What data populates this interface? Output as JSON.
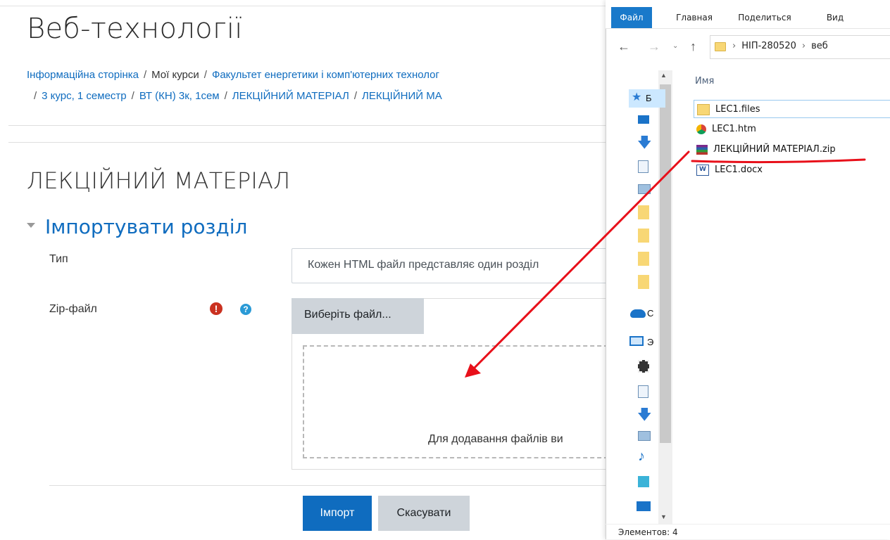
{
  "page": {
    "course_title": "Веб-технології",
    "breadcrumb_line1": [
      "Інформаційна сторінка",
      "Мої курси",
      "Факультет енергетики і комп'ютерних технолог"
    ],
    "breadcrumb_line2": [
      "3 курс, 1 семестр",
      "ВТ (КН) 3к, 1сем",
      "ЛЕКЦІЙНИЙ МАТЕРІАЛ",
      "ЛЕКЦІЙНИЙ МА"
    ],
    "section_title": "ЛЕКЦІЙНИЙ МАТЕРІАЛ",
    "fieldset_legend": "Імпортувати розділ",
    "type_label": "Тип",
    "type_value": "Кожен HTML файл представляє один розділ",
    "zip_label": "Zip-файл",
    "choose_file_button": "Виберіть файл...",
    "drop_hint": "Для додавання файлів ви",
    "import_button": "Імпорт",
    "cancel_button": "Скасувати",
    "required_icon": "exclamation-icon",
    "help_icon": "question-icon"
  },
  "explorer": {
    "ribbon_tabs": [
      "Файл",
      "Главная",
      "Поделиться",
      "Вид"
    ],
    "path": [
      "НІП-280520",
      "веб"
    ],
    "column_header": "Имя",
    "nav_letters": [
      "Б",
      "С",
      "Э"
    ],
    "files": [
      {
        "name": "LEC1.files",
        "icon": "folder-icon"
      },
      {
        "name": "LEC1.htm",
        "icon": "chrome-icon"
      },
      {
        "name": "ЛЕКЦІЙНИЙ МАТЕРІАЛ.zip",
        "icon": "winrar-archive-icon"
      },
      {
        "name": "LEC1.docx",
        "icon": "word-document-icon"
      }
    ],
    "status": "Элементов: 4"
  },
  "annotation": {
    "color": "#e8101a"
  }
}
